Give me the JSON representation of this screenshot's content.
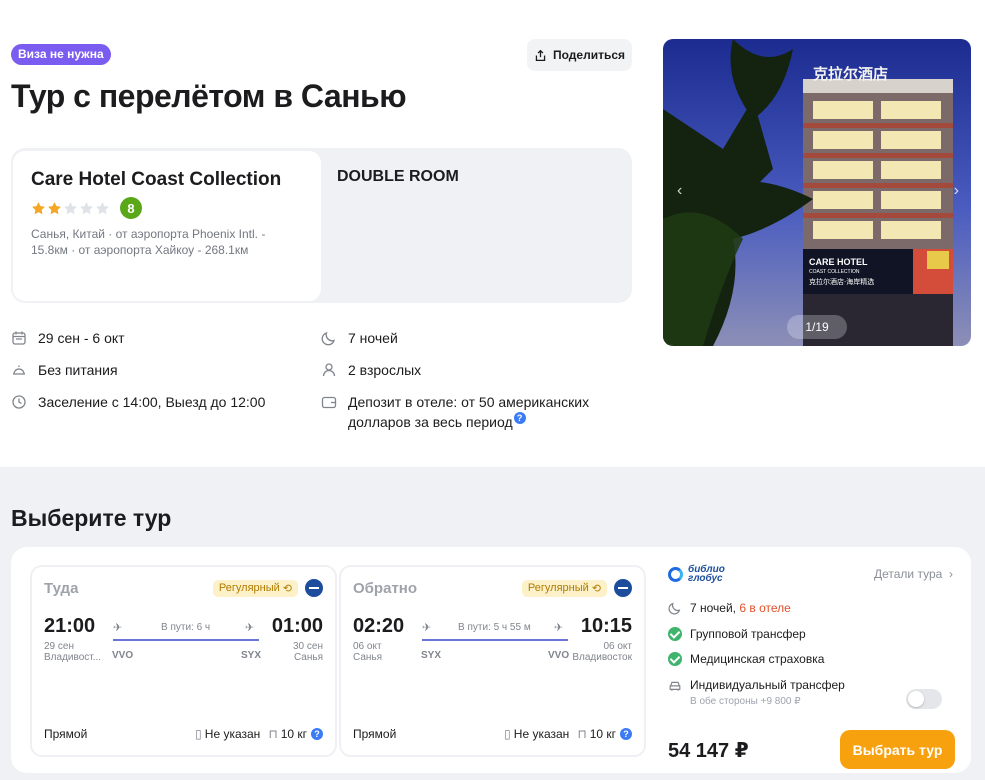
{
  "header": {
    "visa_badge": "Виза не нужна",
    "share_label": "Поделиться",
    "title": "Тур с перелётом в Санью"
  },
  "hotel": {
    "name": "Care Hotel Coast Collection",
    "stars": 2,
    "stars_max": 5,
    "rating": "8",
    "location": "Санья, Китай · от аэропорта Phoenix Intl. - 15.8км · от аэропорта Хайкоу - 268.1км",
    "room_type": "DOUBLE ROOM"
  },
  "facts": {
    "dates": "29 сен - 6 окт",
    "nights": "7 ночей",
    "meal": "Без питания",
    "guests": "2 взрослых",
    "checkin": "Заселение с 14:00, Выезд до 12:00",
    "deposit": "Депозит в отеле: от 50 американских долларов за весь период"
  },
  "photo": {
    "counter": "1/19",
    "sign1": "CARE HOTEL",
    "sign2": "COAST COLLECTION",
    "sign3": "克拉尔酒店·海岸精选",
    "roof_sign": "克拉尔酒店"
  },
  "tour_section": {
    "title": "Выберите тур"
  },
  "outbound": {
    "direction": "Туда",
    "type_label": "Регулярный",
    "dep_time": "21:00",
    "dep_date": "29 сен",
    "dep_city": "Владивост...",
    "dep_code": "VVO",
    "duration": "В пути: 6 ч",
    "arr_time": "01:00",
    "arr_date": "30 сен",
    "arr_city": "Санья",
    "arr_code": "SYX",
    "stops": "Прямой",
    "luggage": "Не указан",
    "hand_luggage": "10 кг"
  },
  "return": {
    "direction": "Обратно",
    "type_label": "Регулярный",
    "dep_time": "02:20",
    "dep_date": "06 окт",
    "dep_city": "Санья",
    "dep_code": "SYX",
    "duration": "В пути: 5 ч 55 м",
    "arr_time": "10:15",
    "arr_date": "06 окт",
    "arr_city": "Владивосток",
    "arr_code": "VVO",
    "stops": "Прямой",
    "luggage": "Не указан",
    "hand_luggage": "10 кг"
  },
  "offer": {
    "operator_line1": "библио",
    "operator_line2": "глобус",
    "details_label": "Детали тура",
    "nights": "7 ночей,",
    "nights_hotel": "6 в отеле",
    "feature1": "Групповой трансфер",
    "feature2": "Медицинская страховка",
    "transfer_label": "Индивидуальный трансфер",
    "transfer_sub": "В обе стороны +9 800 ₽",
    "price": "54 147 ₽",
    "select_label": "Выбрать тур"
  },
  "colors": {
    "accent_orange": "#f7a10f",
    "visa_purple": "#7b5cf0",
    "rating_green": "#5aa71a",
    "check_green": "#3fb46c",
    "route_line": "#6b74d9"
  }
}
